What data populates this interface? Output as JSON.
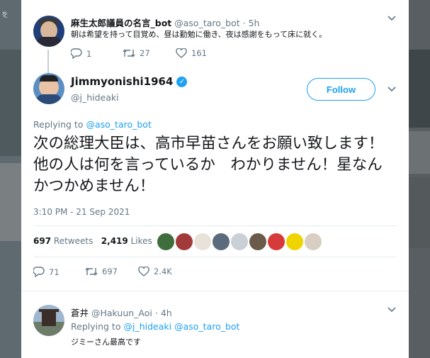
{
  "backdrop": {
    "left_text": "を"
  },
  "parent_tweet": {
    "name": "麻生太郎議員の名言_bot",
    "handle": "@aso_taro_bot",
    "separator": "·",
    "time": "5h",
    "text": "朝は希望を持って目覚め、昼は勤勉に働き、夜は感謝をもって床に就く。",
    "replies": "1",
    "retweets": "27",
    "likes": "161"
  },
  "main_tweet": {
    "name": "Jimmyonishi1964",
    "handle": "@j_hideaki",
    "follow_label": "Follow",
    "replying_prefix": "Replying to",
    "replying_to": "@aso_taro_bot",
    "text": "次の総理大臣は、高市早苗さんをお願い致します！他の人は何を言っているか　わかりません！星なんかつかめません！",
    "timestamp": "3:10 PM - 21 Sep 2021",
    "retweets_count": "697",
    "retweets_label": "Retweets",
    "likes_count": "2,419",
    "likes_label": "Likes",
    "replies": "71",
    "retweets": "697",
    "likes": "2.4K",
    "liker_colors": [
      "#3d6e3b",
      "#a33a3a",
      "#e9e2d8",
      "#5b6b7b",
      "#c9d0d6",
      "#6a5a4a",
      "#d63a3a",
      "#f0d400",
      "#d8cfc2"
    ]
  },
  "reply_tweet": {
    "name": "蒼井",
    "handle": "@Hakuun_Aoi",
    "separator": "·",
    "time": "4h",
    "replying_prefix": "Replying to",
    "replying_to_1": "@j_hideaki",
    "replying_to_2": "@aso_taro_bot",
    "text": "ジミーさん最高です"
  },
  "colors": {
    "accent": "#1da1f2",
    "muted": "#657786",
    "text": "#14171a"
  }
}
